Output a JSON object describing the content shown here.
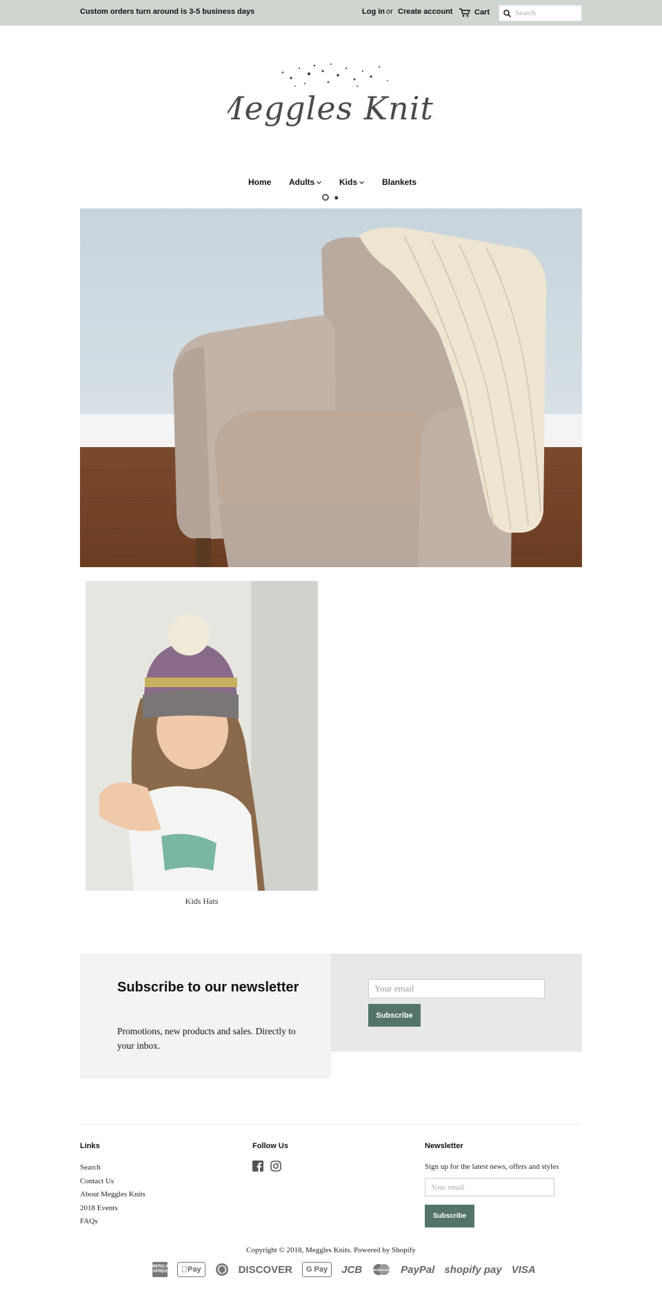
{
  "announcement": "Custom orders turn around is 3-5 business days",
  "account": {
    "login": "Log in",
    "or": "or",
    "create": "Create account"
  },
  "cart": {
    "label": "Cart",
    "icon": "cart-icon"
  },
  "search": {
    "placeholder": "Search",
    "icon": "search-icon"
  },
  "logo": {
    "text": "Meggles Knits"
  },
  "nav": {
    "items": [
      {
        "label": "Home",
        "has_dropdown": false
      },
      {
        "label": "Adults",
        "has_dropdown": true
      },
      {
        "label": "Kids",
        "has_dropdown": true
      },
      {
        "label": "Blankets",
        "has_dropdown": false
      }
    ]
  },
  "slideshow": {
    "slide_count": 2,
    "active_index": 0
  },
  "collections": [
    {
      "title": "Kids Hats"
    }
  ],
  "newsletter": {
    "heading": "Subscribe to our newsletter",
    "text": "Promotions, new products and sales. Directly to your inbox.",
    "email_placeholder": "Your email",
    "button": "Subscribe"
  },
  "footer": {
    "links_title": "Links",
    "links": [
      "Search",
      "Contact Us",
      "About Meggles Knits",
      "2018 Events",
      "FAQs"
    ],
    "follow_title": "Follow Us",
    "social": [
      "facebook-icon",
      "instagram-icon"
    ],
    "newsletter_title": "Newsletter",
    "newsletter_text": "Sign up for the latest news, offers and styles",
    "email_placeholder": "Your email",
    "button": "Subscribe",
    "copyright": "Copyright © 2018, Meggles Knits. Powered by Shopify"
  },
  "payment_icons": {
    "amex": "AMERICAN EXPRESS",
    "apple_pay": "Pay",
    "diners": "",
    "discover": "DISCOVER",
    "google_pay": "G Pay",
    "jcb": "JCB",
    "master": "MasterCard",
    "paypal": "PayPal",
    "shopify_pay": "shopify pay",
    "visa": "VISA"
  },
  "colors": {
    "topbar_bg": "#cfd6cf",
    "button_bg": "#557469",
    "newsletter_left_bg": "#f3f3f3",
    "newsletter_right_bg": "#e8e8e8"
  }
}
